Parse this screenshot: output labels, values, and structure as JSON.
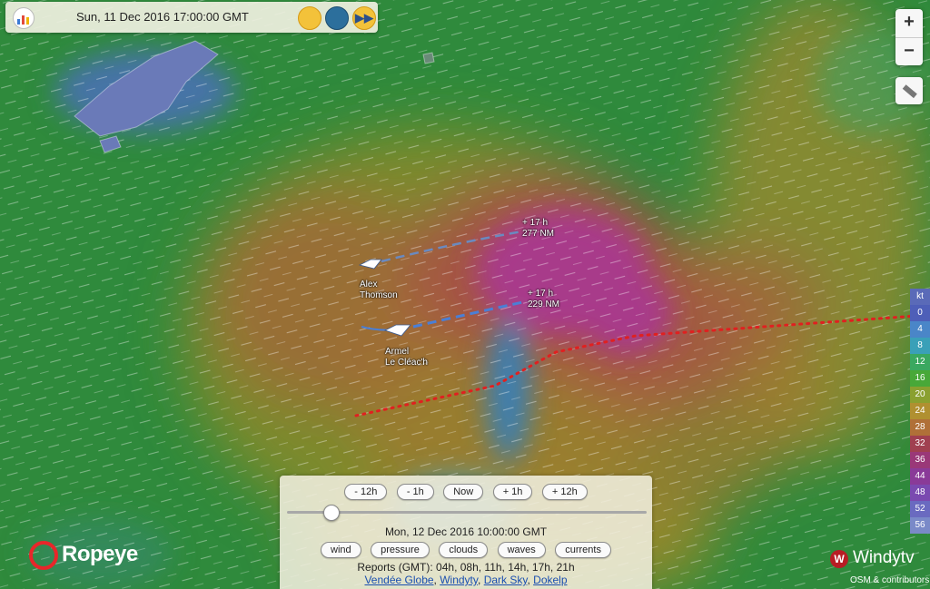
{
  "topbar": {
    "datetime": "Sun, 11 Dec 2016 17:00:00 GMT",
    "icons": [
      "app-logo-icon",
      "sun-icon",
      "globe-icon",
      "fast-forward-icon"
    ]
  },
  "map_controls": {
    "zoom_in": "+",
    "zoom_out": "−"
  },
  "boats": [
    {
      "name_line1": "Alex",
      "name_line2": "Thomson",
      "forecast_time": "+ 17 h",
      "forecast_distance": "277 NM"
    },
    {
      "name_line1": "Armel",
      "name_line2": "Le Cléac'h",
      "forecast_time": "+ 17 h",
      "forecast_distance": "229 NM"
    }
  ],
  "legend": {
    "unit": "kt",
    "values": [
      "0",
      "4",
      "8",
      "12",
      "16",
      "20",
      "24",
      "28",
      "32",
      "36",
      "44",
      "48",
      "52",
      "56"
    ],
    "colors": [
      "#4e5fb8",
      "#4a86c8",
      "#3aa0b8",
      "#3aa860",
      "#48a838",
      "#8aa030",
      "#b09030",
      "#b07038",
      "#a04050",
      "#9a3878",
      "#8a3a98",
      "#7a4ab0",
      "#6a6ac0",
      "#7a8ac8"
    ]
  },
  "timeline": {
    "buttons": [
      "- 12h",
      "- 1h",
      "Now",
      "+ 1h",
      "+ 12h"
    ],
    "progress": 0.12,
    "current_time": "Mon, 12 Dec 2016 10:00:00 GMT",
    "layers": [
      "wind",
      "pressure",
      "clouds",
      "waves",
      "currents"
    ],
    "reports": "Reports (GMT): 04h, 08h, 11h, 14h, 17h, 21h",
    "links": [
      "Vendée Globe",
      "Windyty",
      "Dark Sky",
      "Dokelp"
    ]
  },
  "branding": {
    "ropeye": "Ropeye",
    "windy": "Windytv",
    "attribution": "OSM & contributors"
  },
  "colors": {
    "route_line": "#e02020",
    "track_line": "#4a7fd6",
    "zone_green": "#2f8a3c",
    "zone_storm": "#a03a88"
  }
}
